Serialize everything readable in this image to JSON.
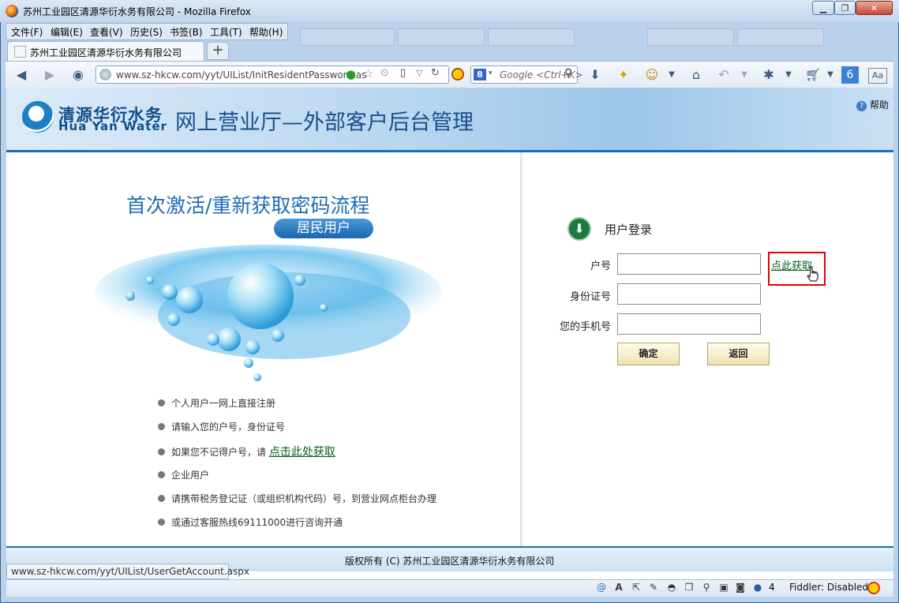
{
  "window": {
    "title": "苏州工业园区清源华衍水务有限公司 - Mozilla Firefox",
    "minimize": "▁",
    "maximize": "❐",
    "close": "✕"
  },
  "menubar": {
    "items": [
      "文件(F)",
      "编辑(E)",
      "查看(V)",
      "历史(S)",
      "书签(B)",
      "工具(T)",
      "帮助(H)"
    ]
  },
  "tabs": {
    "active_label": "苏州工业园区清源华衍水务有限公司",
    "new_tab": "+"
  },
  "navbar": {
    "url": "www.sz-hkcw.com/yyt/UIList/InitResidentPassword.as",
    "search_placeholder": "Google <Ctrl+K>",
    "search_engine_icon": "8"
  },
  "site": {
    "logo_cn": "清源华衍水务",
    "logo_en": "Hua Yan Water",
    "portal_title": "网上营业厅—外部客户后台管理",
    "help": "帮助"
  },
  "left_panel": {
    "flow_title": "首次激活/重新获取密码流程",
    "resident_tag": "居民用户",
    "bullets": [
      {
        "text": "个人用户一网上直接注册"
      },
      {
        "text": "请输入您的户号，身份证号"
      },
      {
        "text": "如果您不记得户号，请 ",
        "link": "点击此处获取"
      },
      {
        "text": "企业用户"
      },
      {
        "text": "请携带税务登记证（或组织机构代码）号，到营业网点柜台办理"
      },
      {
        "text": "或通过客服热线69111000进行咨询开通"
      }
    ]
  },
  "login": {
    "title": "用户登录",
    "account_label": "户号",
    "id_label": "身份证号",
    "phone_label": "您的手机号",
    "account_value": "",
    "id_value": "",
    "phone_value": "",
    "get_account_link": "点此获取",
    "confirm": "确定",
    "back": "返回"
  },
  "footer": {
    "copyright": "版权所有 (C)  苏州工业园区清源华衍水务有限公司"
  },
  "statusbar": {
    "hover_url": "www.sz-hkcw.com/yyt/UIList/UserGetAccount.aspx",
    "addon_count": "4",
    "fiddler": "Fiddler: Disabled"
  },
  "colors": {
    "brand_blue": "#1a6fb8",
    "link_green": "#0a5c1c",
    "highlight_red": "#e30000"
  }
}
